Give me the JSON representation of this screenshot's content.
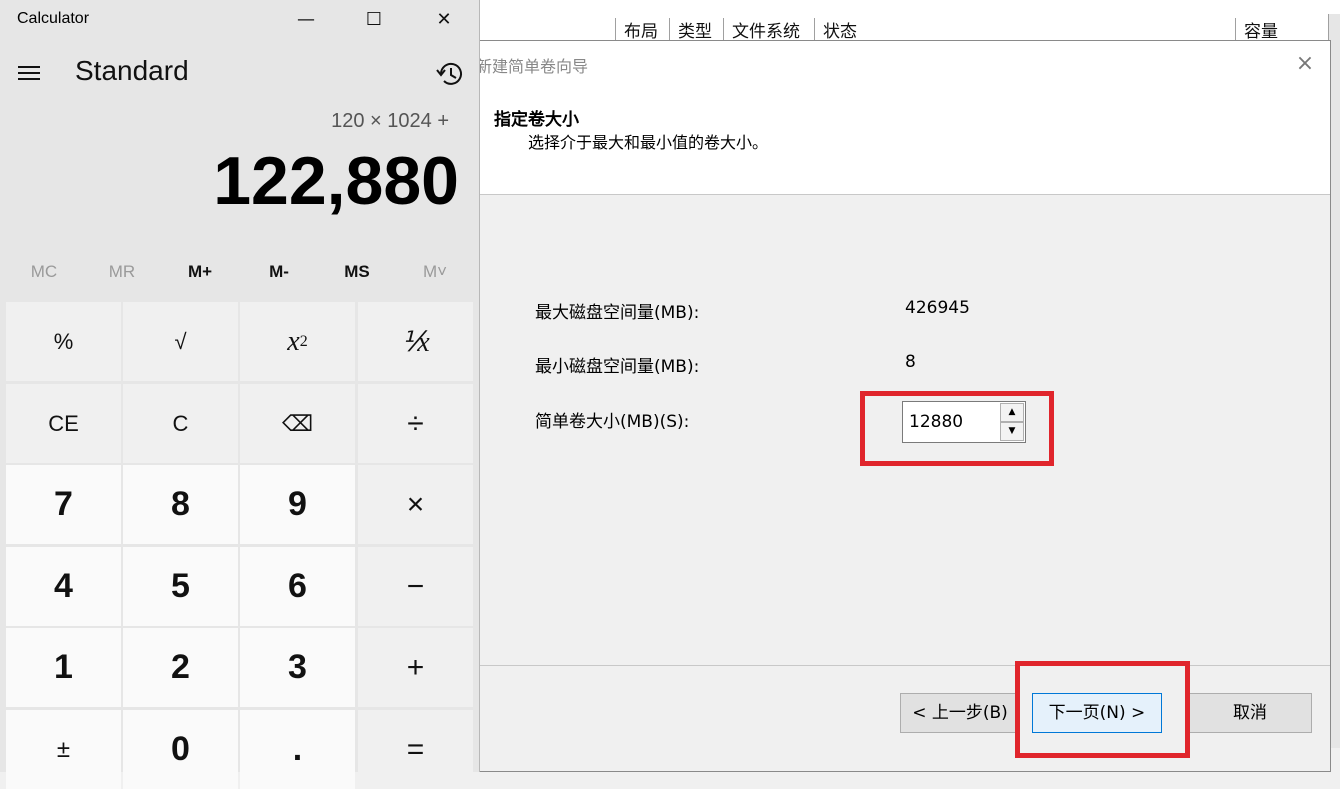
{
  "disk_manager": {
    "columns": [
      "布局",
      "类型",
      "文件系统",
      "状态",
      "容量"
    ]
  },
  "wizard": {
    "title": "新建简单卷向导",
    "close_icon": "×",
    "heading": "指定卷大小",
    "subheading": "选择介于最大和最小值的卷大小。",
    "max_label": "最大磁盘空间量(MB):",
    "max_value": "426945",
    "min_label": "最小磁盘空间量(MB):",
    "min_value": "8",
    "size_label": "简单卷大小(MB)(S):",
    "size_value": "12880",
    "spin_up": "▲",
    "spin_down": "▼",
    "back_label": "< 上一步(B)",
    "next_label": "下一页(N) >",
    "cancel_label": "取消"
  },
  "calculator": {
    "title": "Calculator",
    "mode": "Standard",
    "expression": "120 × 1024 +",
    "display": "122,880",
    "window_controls": {
      "minimize": "—",
      "maximize": "☐",
      "close": "✕"
    },
    "memory": [
      {
        "label": "MC",
        "enabled": false
      },
      {
        "label": "MR",
        "enabled": false
      },
      {
        "label": "M+",
        "enabled": true
      },
      {
        "label": "M-",
        "enabled": true
      },
      {
        "label": "MS",
        "enabled": true
      },
      {
        "label": "M˅",
        "enabled": false
      }
    ],
    "keys": {
      "percent": "%",
      "sqrt": "√",
      "square_base": "x",
      "square_exp": "2",
      "reciprocal": "⅟x",
      "ce": "CE",
      "c": "C",
      "backspace": "⌫",
      "divide": "÷",
      "seven": "7",
      "eight": "8",
      "nine": "9",
      "multiply": "×",
      "four": "4",
      "five": "5",
      "six": "6",
      "minus": "−",
      "one": "1",
      "two": "2",
      "three": "3",
      "plus": "+",
      "negate": "±",
      "zero": "0",
      "decimal": ".",
      "equals": "="
    }
  },
  "colors": {
    "highlight_red": "#e0252c",
    "primary_button_border": "#0078d7"
  }
}
